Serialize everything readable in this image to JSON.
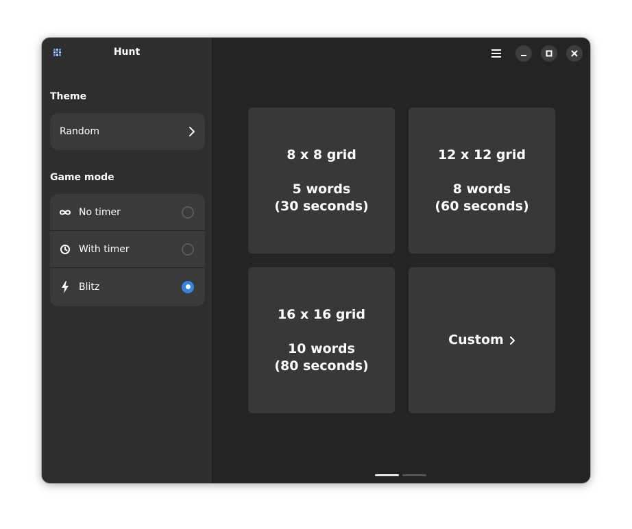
{
  "app": {
    "title": "Hunt"
  },
  "sidebar": {
    "theme_label": "Theme",
    "theme_value": "Random",
    "game_mode_label": "Game mode",
    "modes": [
      {
        "label": "No timer",
        "icon": "infinity-icon",
        "selected": false
      },
      {
        "label": "With timer",
        "icon": "timer-icon",
        "selected": false
      },
      {
        "label": "Blitz",
        "icon": "lightning-icon",
        "selected": true
      }
    ]
  },
  "header": {
    "buttons": [
      "menu-icon",
      "minimize-icon",
      "maximize-icon",
      "close-icon"
    ]
  },
  "grid_options": [
    {
      "size": "8 x 8 grid",
      "words": "5 words",
      "time": "(30 seconds)"
    },
    {
      "size": "12 x 12 grid",
      "words": "8 words",
      "time": "(60 seconds)"
    },
    {
      "size": "16 x 16 grid",
      "words": "10 words",
      "time": "(80 seconds)"
    },
    {
      "label": "Custom"
    }
  ],
  "pager": {
    "pages": 2,
    "current": 1
  },
  "colors": {
    "accent": "#3584e4",
    "sidebar_bg": "#2e2e2e",
    "content_bg": "#242424",
    "card_bg": "#383838"
  }
}
